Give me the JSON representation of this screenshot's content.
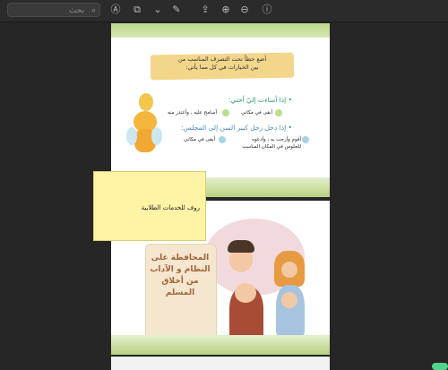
{
  "toolbar": {
    "search_placeholder": "بحث",
    "icons": [
      "annotate-icon",
      "share-icon",
      "chevron-down-icon",
      "pen-icon",
      "export-icon",
      "zoom-in-icon",
      "zoom-out-icon",
      "info-icon"
    ]
  },
  "page1": {
    "title_line1": "أضع خطاً تحت التصرف المناسب من",
    "title_line2": "بين الخيارات في كل مما يأتي:",
    "q1": "• إذا أساءت إليّ أختي:",
    "q1_opt1": "أبقى في مكاني",
    "q1_opt2": "أسامح عليه ، وأعتذر منه",
    "q2": "• إذا دخل رجل كبير السن إلى المجلس:",
    "q2_opt1": "أقوم وأرحب به ، وأدعوه",
    "q2_opt1b": "للجلوس في المكان المناسب",
    "q2_opt2": "أبقى في مكاني"
  },
  "note": {
    "text": "روف للخدمات الطلابية"
  },
  "page2": {
    "scroll_line1": "المحافظة على",
    "scroll_line2": "النظام و الآداب",
    "scroll_line3": "من أخلاق",
    "scroll_line4": "المسلم"
  }
}
